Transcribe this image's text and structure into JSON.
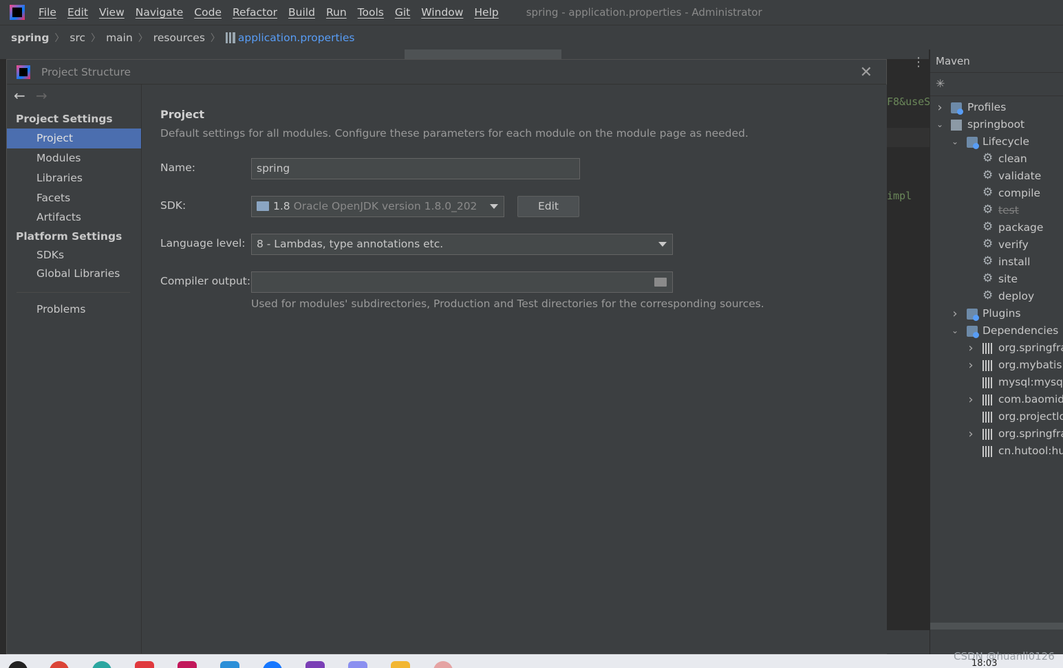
{
  "menubar": {
    "items": [
      "File",
      "Edit",
      "View",
      "Navigate",
      "Code",
      "Refactor",
      "Build",
      "Run",
      "Tools",
      "Git",
      "Window",
      "Help"
    ],
    "window_title": "spring - application.properties - Administrator"
  },
  "breadcrumb": {
    "project": "spring",
    "parts": [
      "src",
      "main",
      "resources"
    ],
    "file": "application.properties"
  },
  "editor": {
    "fragment_1": "F8&useS",
    "fragment_2": "impl"
  },
  "maven": {
    "title": "Maven",
    "tree": [
      {
        "label": "Profiles",
        "depth": 0,
        "chevron": "right",
        "icon": "profiles-icon"
      },
      {
        "label": "springboot",
        "depth": 0,
        "chevron": "down",
        "icon": "module-icon"
      },
      {
        "label": "Lifecycle",
        "depth": 1,
        "chevron": "down",
        "icon": "lifecycle-icon"
      },
      {
        "label": "clean",
        "depth": 2,
        "chevron": "",
        "icon": "gear-icon"
      },
      {
        "label": "validate",
        "depth": 2,
        "chevron": "",
        "icon": "gear-icon"
      },
      {
        "label": "compile",
        "depth": 2,
        "chevron": "",
        "icon": "gear-icon"
      },
      {
        "label": "test",
        "depth": 2,
        "chevron": "",
        "icon": "gear-icon",
        "strike": true
      },
      {
        "label": "package",
        "depth": 2,
        "chevron": "",
        "icon": "gear-icon"
      },
      {
        "label": "verify",
        "depth": 2,
        "chevron": "",
        "icon": "gear-icon"
      },
      {
        "label": "install",
        "depth": 2,
        "chevron": "",
        "icon": "gear-icon"
      },
      {
        "label": "site",
        "depth": 2,
        "chevron": "",
        "icon": "gear-icon"
      },
      {
        "label": "deploy",
        "depth": 2,
        "chevron": "",
        "icon": "gear-icon"
      },
      {
        "label": "Plugins",
        "depth": 1,
        "chevron": "right",
        "icon": "plugins-icon"
      },
      {
        "label": "Dependencies",
        "depth": 1,
        "chevron": "down",
        "icon": "dependencies-icon"
      },
      {
        "label": "org.springfra",
        "depth": 2,
        "chevron": "right",
        "icon": "library-icon"
      },
      {
        "label": "org.mybatis.s",
        "depth": 2,
        "chevron": "right",
        "icon": "library-icon"
      },
      {
        "label": "mysql:mysql-",
        "depth": 2,
        "chevron": "",
        "icon": "library-icon"
      },
      {
        "label": "com.baomidc",
        "depth": 2,
        "chevron": "right",
        "icon": "library-icon"
      },
      {
        "label": "org.projectlo",
        "depth": 2,
        "chevron": "",
        "icon": "library-icon"
      },
      {
        "label": "org.springfra",
        "depth": 2,
        "chevron": "right",
        "icon": "library-icon"
      },
      {
        "label": "cn.hutool:hut",
        "depth": 2,
        "chevron": "",
        "icon": "library-icon"
      }
    ]
  },
  "dialog": {
    "title": "Project Structure",
    "nav": {
      "project_settings_header": "Project Settings",
      "project_settings_items": [
        "Project",
        "Modules",
        "Libraries",
        "Facets",
        "Artifacts"
      ],
      "platform_settings_header": "Platform Settings",
      "platform_settings_items": [
        "SDKs",
        "Global Libraries"
      ],
      "problems": "Problems",
      "selected": "Project"
    },
    "content": {
      "title": "Project",
      "description": "Default settings for all modules. Configure these parameters for each module on the module page as needed.",
      "name_label": "Name:",
      "name_value": "spring",
      "sdk_label": "SDK:",
      "sdk_version": "1.8",
      "sdk_name": "Oracle OpenJDK version 1.8.0_202",
      "edit_label": "Edit",
      "language_level_label": "Language level:",
      "language_level_value": "8 - Lambdas, type annotations etc.",
      "compiler_output_label": "Compiler output:",
      "compiler_output_value": "",
      "compiler_output_hint": "Used for modules' subdirectories, Production and Test directories for the corresponding sources."
    }
  },
  "taskbar": {
    "watermark": "CSDN @huanli0126",
    "clock": "18:03"
  },
  "colors": {
    "accent": "#4b6eaf",
    "panel": "#3c3f41",
    "editor": "#2b2b2b",
    "link": "#589df6"
  }
}
